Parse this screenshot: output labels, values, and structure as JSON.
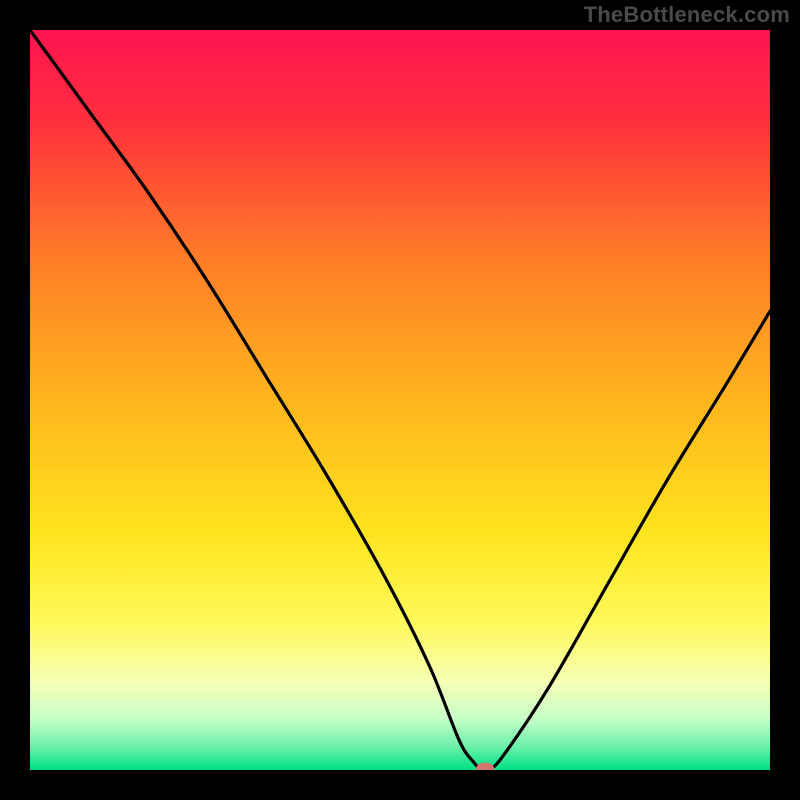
{
  "watermark": "TheBottleneck.com",
  "chart_data": {
    "type": "line",
    "title": "",
    "xlabel": "",
    "ylabel": "",
    "xlim": [
      0,
      100
    ],
    "ylim": [
      0,
      100
    ],
    "background_gradient": {
      "stops": [
        {
          "offset": 0,
          "color": "#ff1450"
        },
        {
          "offset": 12,
          "color": "#ff2e3e"
        },
        {
          "offset": 30,
          "color": "#ff7a28"
        },
        {
          "offset": 50,
          "color": "#ffb51e"
        },
        {
          "offset": 68,
          "color": "#ffe41e"
        },
        {
          "offset": 80,
          "color": "#fff95a"
        },
        {
          "offset": 88,
          "color": "#f6ffb4"
        },
        {
          "offset": 93,
          "color": "#c8ffc8"
        },
        {
          "offset": 97,
          "color": "#66f0a8"
        },
        {
          "offset": 100,
          "color": "#00e085"
        }
      ]
    },
    "series": [
      {
        "name": "bottleneck-curve",
        "x": [
          0,
          8,
          16,
          24,
          32,
          40,
          48,
          54,
          58,
          60,
          61,
          62,
          64,
          70,
          78,
          86,
          94,
          100
        ],
        "y": [
          100,
          89,
          78,
          66,
          53,
          40,
          26,
          14,
          4,
          1,
          0,
          0,
          2,
          11,
          25,
          39,
          52,
          62
        ]
      }
    ],
    "marker": {
      "name": "optimal-point",
      "x": 61.5,
      "y": 0.2,
      "color": "#d6776f",
      "rx": 9,
      "ry": 6
    }
  },
  "colors": {
    "frame": "#000000",
    "curve": "#000000",
    "watermark": "#4a4a4a"
  }
}
